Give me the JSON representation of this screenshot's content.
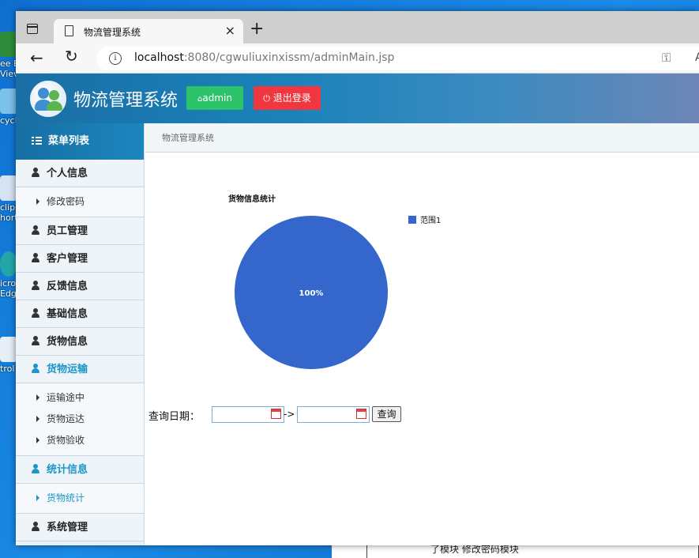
{
  "desktop": {
    "icons": [
      "ee E\nView",
      "cycl",
      "clips\nhort",
      "icro\nEdg",
      "trol"
    ],
    "bg_window_text": "了模块  修改密码模块"
  },
  "browser": {
    "tab_title": "物流管理系统",
    "url_host": "localhost",
    "url_rest": ":8080/cgwuliuxinxissm/adminMain.jsp",
    "close_glyph": "×",
    "newtab_glyph": "+",
    "back_glyph": "←",
    "reload_glyph": "↻",
    "key_glyph": "⚿",
    "aa_glyph": "A"
  },
  "header": {
    "app_title": "物流管理系统",
    "admin_label": "admin",
    "logout_label": "退出登录",
    "colors": {
      "admin": "#2cc36b",
      "logout": "#f0373f"
    }
  },
  "sidebar": {
    "heading": "菜单列表",
    "sections": [
      {
        "label": "个人信息",
        "items": [
          "修改密码"
        ]
      },
      {
        "label": "员工管理"
      },
      {
        "label": "客户管理"
      },
      {
        "label": "反馈信息"
      },
      {
        "label": "基础信息"
      },
      {
        "label": "货物信息"
      },
      {
        "label": "货物运输",
        "items": [
          "运输途中",
          "货物运达",
          "货物验收"
        ]
      },
      {
        "label": "统计信息",
        "items": [
          "货物统计"
        ]
      },
      {
        "label": "系统管理"
      }
    ]
  },
  "breadcrumb": "物流管理系统",
  "chart_data": {
    "type": "pie",
    "title": "货物信息统计",
    "series": [
      {
        "name": "范围1",
        "value": 100,
        "label": "100%",
        "color": "#3466cc"
      }
    ],
    "legend_position": "top-right"
  },
  "query": {
    "label": "查询日期：",
    "separator": "->",
    "button": "查询",
    "start_value": "",
    "end_value": ""
  }
}
